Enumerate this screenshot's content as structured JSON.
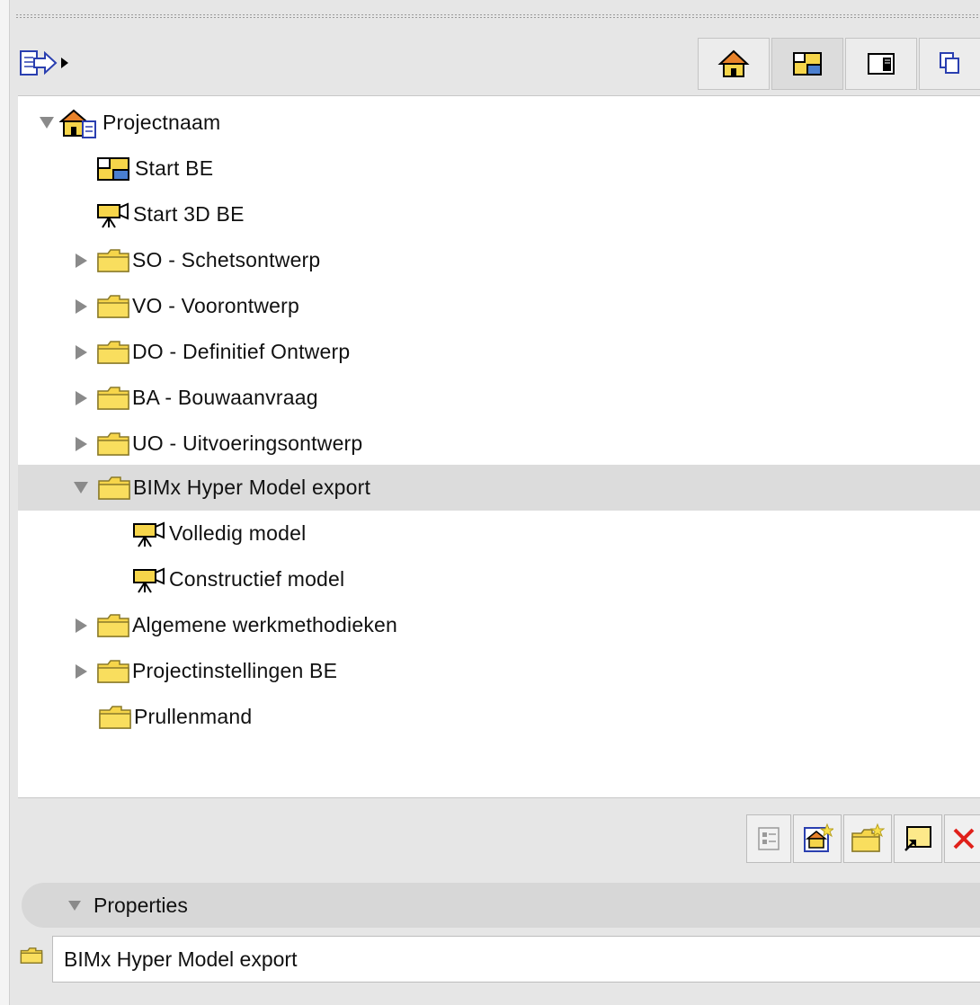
{
  "tree": {
    "root": {
      "label": "Projectnaam",
      "expanded": true
    },
    "items": [
      {
        "label": "Start BE",
        "icon": "floor-plan-view-icon"
      },
      {
        "label": "Start 3D BE",
        "icon": "3d-camera-view-icon"
      },
      {
        "label": "SO - Schetsontwerp",
        "icon": "folder-icon",
        "expanded": false
      },
      {
        "label": "VO - Voorontwerp",
        "icon": "folder-icon",
        "expanded": false
      },
      {
        "label": "DO - Definitief Ontwerp",
        "icon": "folder-icon",
        "expanded": false
      },
      {
        "label": "BA - Bouwaanvraag",
        "icon": "folder-icon",
        "expanded": false
      },
      {
        "label": "UO - Uitvoeringsontwerp",
        "icon": "folder-icon",
        "expanded": false
      },
      {
        "label": "BIMx Hyper Model export",
        "icon": "folder-icon",
        "expanded": true,
        "selected": true
      },
      {
        "label": "Volledig model",
        "icon": "3d-camera-view-icon"
      },
      {
        "label": "Constructief model",
        "icon": "3d-camera-view-icon"
      },
      {
        "label": "Algemene werkmethodieken",
        "icon": "folder-icon",
        "expanded": false
      },
      {
        "label": "Projectinstellingen BE",
        "icon": "folder-icon",
        "expanded": false
      },
      {
        "label": "Prullenmand",
        "icon": "folder-icon"
      }
    ]
  },
  "properties": {
    "header": "Properties",
    "name_value": "BIMx Hyper Model export"
  },
  "colors": {
    "selected_row": "#dcdcdc",
    "folder_yellow": "#f6d54a",
    "delete_red": "#e0201a"
  }
}
